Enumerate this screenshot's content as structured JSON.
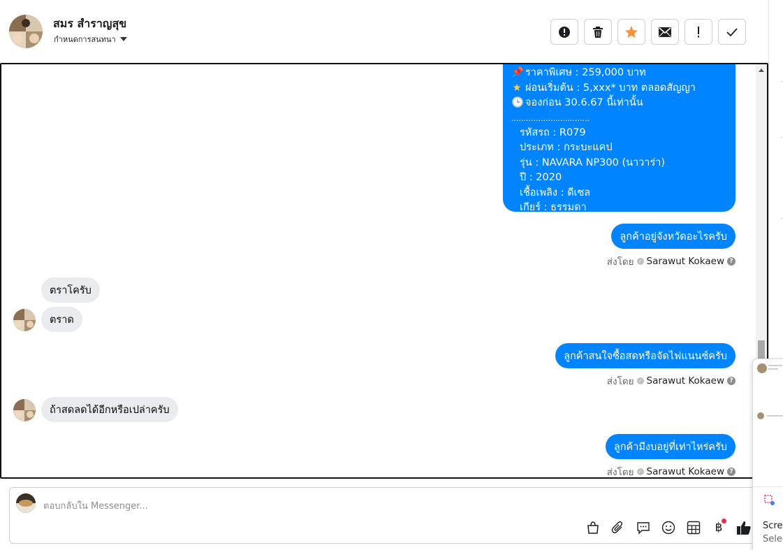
{
  "header": {
    "contact_name": "สมร สำราญสุข",
    "assign_label": "กำหนดการสนทนา",
    "actions": [
      "report-spam",
      "delete",
      "star",
      "mark-unread",
      "mark-important",
      "mark-done"
    ]
  },
  "chat": {
    "card_lines": {
      "l1": "ราคาพิเศษ : 259,000 บาท",
      "l2": "ผ่อนเริ่มต้น : 5,xxx* บาท ตลอดสัญญา",
      "l3": "จองก่อน 30.6.67 นี้เท่านั้น",
      "sep": "................................",
      "l4": "รหัสรถ : R079",
      "l5": "ประเภท : กระบะแคป",
      "l6": "รุ่น : NAVARA NP300 (นาวาร่า)",
      "l7": "ปี : 2020",
      "l8": "เชื้อเพลิง : ดีเซล",
      "l9": "เกียร์ : ธรรมดา"
    },
    "msg1": "ลูกค้าอยู่จังหวัดอะไรครับ",
    "msg2": "ตราโครับ",
    "msg3": "ตราด",
    "msg4": "ลูกค้าสนใจซื้อสดหรือจัดไฟแนนซ์ครับ",
    "msg5": "ถ้าสดลดได้อีกหรือเปล่าครับ",
    "msg6": "ลูกค้ามีงบอยู่ที่เท่าไหร่ครับ",
    "sent_by_label": "ส่งโดย",
    "agent_name": "Sarawut Kokaew"
  },
  "composer": {
    "placeholder": "ตอบกลับใน Messenger..."
  },
  "popup": {
    "line1": "Scre",
    "line2": "Selec"
  },
  "colors": {
    "outgoing": "#0084ff",
    "incoming": "#e9ebee",
    "star": "#f7923a"
  }
}
